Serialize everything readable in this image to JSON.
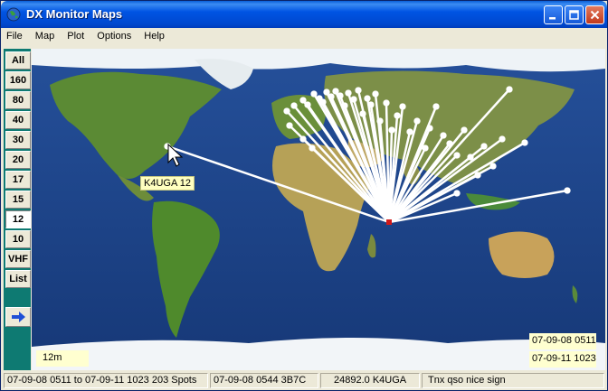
{
  "window": {
    "title": "DX Monitor Maps",
    "controls": {
      "minimize": "minimize",
      "maximize": "maximize",
      "close": "close"
    }
  },
  "menu": [
    "File",
    "Map",
    "Plot",
    "Options",
    "Help"
  ],
  "bands": {
    "items": [
      "All",
      "160",
      "80",
      "40",
      "30",
      "20",
      "17",
      "15",
      "12",
      "10",
      "VHF",
      "List"
    ],
    "active": "12"
  },
  "map": {
    "spot_label": "K4UGA 12",
    "band_label": "12m",
    "date_start": "07-09-08 0511",
    "date_end": "07-09-11 1023",
    "colors": {
      "path": "#ffffff",
      "origin": "#d11a1a",
      "ocean": "#1b3f8a"
    }
  },
  "status": {
    "range": "07-09-08 0511 to 07-09-11 1023 203 Spots",
    "last_spot": "07-09-08 0544 3B7C",
    "freq_call": "24892.0 K4UGA",
    "comment": "Tnx qso nice sign"
  },
  "icons": {
    "app": "globe-icon",
    "next": "arrow-right-icon",
    "cursor": "mouse-pointer-icon"
  }
}
